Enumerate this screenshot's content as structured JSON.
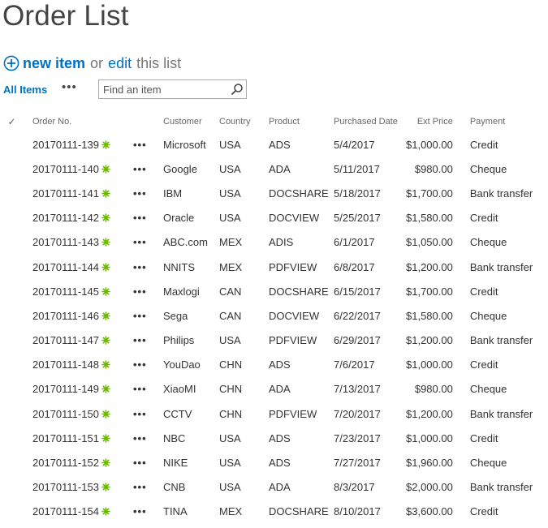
{
  "page": {
    "title": "Order List"
  },
  "actions": {
    "new_word": "new",
    "item_word": "item",
    "or_text": "or",
    "edit_text": "edit",
    "this_list_text": "this list"
  },
  "view": {
    "current_view": "All Items",
    "more_label": "•••"
  },
  "search": {
    "placeholder": "Find an item",
    "value": ""
  },
  "colors": {
    "link_blue": "#0072c6",
    "new_badge_green": "#6bb700",
    "header_gray": "#666666"
  },
  "icons": {
    "new_item": "plus-circle-icon",
    "search": "search-icon",
    "select_all": "checkmark-icon",
    "new_badge": "new-item-asterisk-icon",
    "item_menu": "ellipsis-icon"
  },
  "table": {
    "check_glyph": "✓",
    "row_menu_label": "•••",
    "headers": {
      "order_no": "Order No.",
      "customer": "Customer",
      "country": "Country",
      "product": "Product",
      "purchased_date": "Purchased Date",
      "ext_price": "Ext Price",
      "payment": "Payment"
    },
    "rows": [
      {
        "order_no": "20170111-139",
        "customer": "Microsoft",
        "country": "USA",
        "product": "ADS",
        "purchased_date": "5/4/2017",
        "ext_price": "$1,000.00",
        "payment": "Credit"
      },
      {
        "order_no": "20170111-140",
        "customer": "Google",
        "country": "USA",
        "product": "ADA",
        "purchased_date": "5/11/2017",
        "ext_price": "$980.00",
        "payment": "Cheque"
      },
      {
        "order_no": "20170111-141",
        "customer": "IBM",
        "country": "USA",
        "product": "DOCSHARE",
        "purchased_date": "5/18/2017",
        "ext_price": "$1,700.00",
        "payment": "Bank transfer"
      },
      {
        "order_no": "20170111-142",
        "customer": "Oracle",
        "country": "USA",
        "product": "DOCVIEW",
        "purchased_date": "5/25/2017",
        "ext_price": "$1,580.00",
        "payment": "Credit"
      },
      {
        "order_no": "20170111-143",
        "customer": "ABC.com",
        "country": "MEX",
        "product": "ADIS",
        "purchased_date": "6/1/2017",
        "ext_price": "$1,050.00",
        "payment": "Cheque"
      },
      {
        "order_no": "20170111-144",
        "customer": "NNITS",
        "country": "MEX",
        "product": "PDFVIEW",
        "purchased_date": "6/8/2017",
        "ext_price": "$1,200.00",
        "payment": "Bank transfer"
      },
      {
        "order_no": "20170111-145",
        "customer": "Maxlogi",
        "country": "CAN",
        "product": "DOCSHARE",
        "purchased_date": "6/15/2017",
        "ext_price": "$1,700.00",
        "payment": "Credit"
      },
      {
        "order_no": "20170111-146",
        "customer": "Sega",
        "country": "CAN",
        "product": "DOCVIEW",
        "purchased_date": "6/22/2017",
        "ext_price": "$1,580.00",
        "payment": "Cheque"
      },
      {
        "order_no": "20170111-147",
        "customer": "Philips",
        "country": "USA",
        "product": "PDFVIEW",
        "purchased_date": "6/29/2017",
        "ext_price": "$1,200.00",
        "payment": "Bank transfer"
      },
      {
        "order_no": "20170111-148",
        "customer": "YouDao",
        "country": "CHN",
        "product": "ADS",
        "purchased_date": "7/6/2017",
        "ext_price": "$1,000.00",
        "payment": "Credit"
      },
      {
        "order_no": "20170111-149",
        "customer": "XiaoMI",
        "country": "CHN",
        "product": "ADA",
        "purchased_date": "7/13/2017",
        "ext_price": "$980.00",
        "payment": "Cheque"
      },
      {
        "order_no": "20170111-150",
        "customer": "CCTV",
        "country": "CHN",
        "product": "PDFVIEW",
        "purchased_date": "7/20/2017",
        "ext_price": "$1,200.00",
        "payment": "Bank transfer"
      },
      {
        "order_no": "20170111-151",
        "customer": "NBC",
        "country": "USA",
        "product": "ADS",
        "purchased_date": "7/23/2017",
        "ext_price": "$1,000.00",
        "payment": "Credit"
      },
      {
        "order_no": "20170111-152",
        "customer": "NIKE",
        "country": "USA",
        "product": "ADS",
        "purchased_date": "7/27/2017",
        "ext_price": "$1,960.00",
        "payment": "Cheque"
      },
      {
        "order_no": "20170111-153",
        "customer": "CNB",
        "country": "USA",
        "product": "ADA",
        "purchased_date": "8/3/2017",
        "ext_price": "$2,000.00",
        "payment": "Bank transfer"
      },
      {
        "order_no": "20170111-154",
        "customer": "TINA",
        "country": "MEX",
        "product": "DOCSHARE",
        "purchased_date": "8/10/2017",
        "ext_price": "$3,600.00",
        "payment": "Credit"
      }
    ]
  }
}
